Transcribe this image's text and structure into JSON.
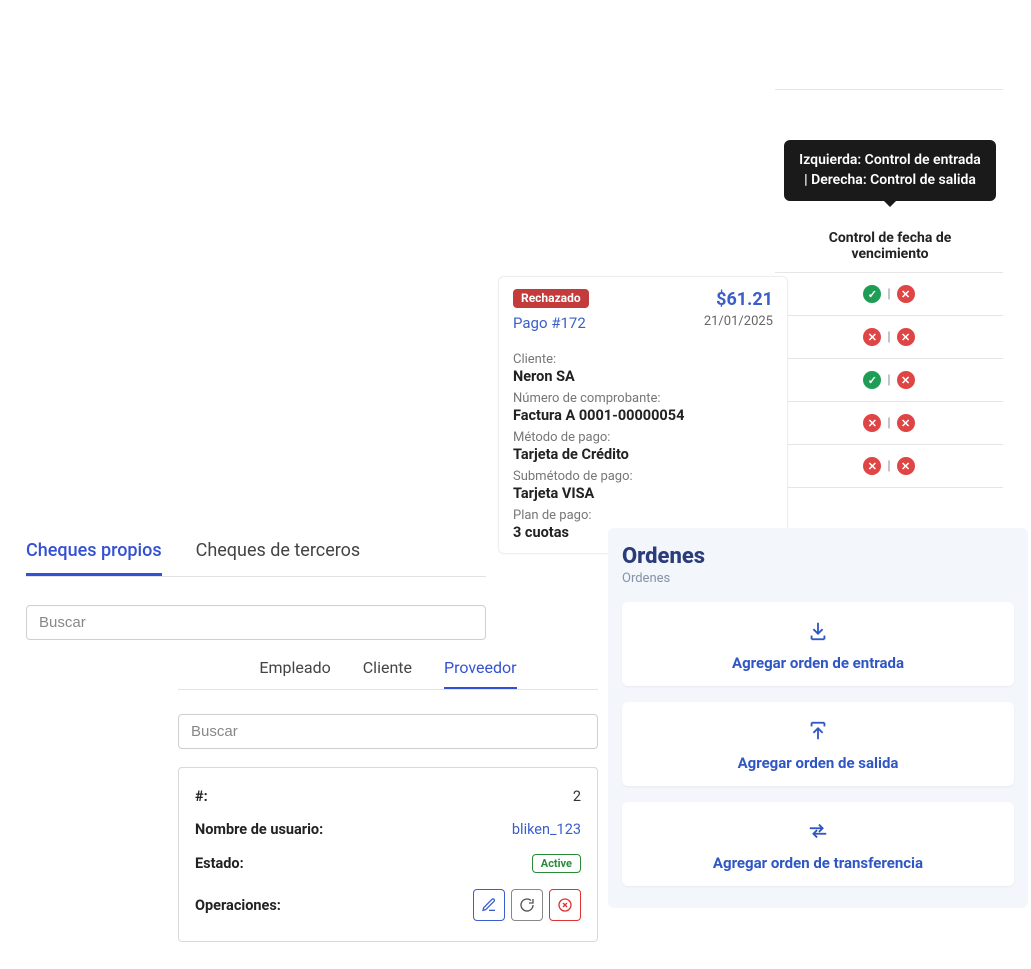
{
  "expiry": {
    "tooltip": "Izquierda: Control de entrada | Derecha: Control de salida",
    "header": "Control de fecha de vencimiento",
    "rows": [
      {
        "left": "ok",
        "right": "no"
      },
      {
        "left": "no",
        "right": "no"
      },
      {
        "left": "ok",
        "right": "no"
      },
      {
        "left": "no",
        "right": "no"
      },
      {
        "left": "no",
        "right": "no"
      }
    ],
    "separator": "|"
  },
  "payment": {
    "status_badge": "Rechazado",
    "title": "Pago #172",
    "amount": "$61.21",
    "date": "21/01/2025",
    "fields": {
      "client_label": "Cliente:",
      "client_value": "Neron SA",
      "receipt_label": "Número de comprobante:",
      "receipt_value": "Factura A 0001-00000054",
      "method_label": "Método de pago:",
      "method_value": "Tarjeta de Crédito",
      "submethod_label": "Submétodo de pago:",
      "submethod_value": "Tarjeta VISA",
      "plan_label": "Plan de pago:",
      "plan_value": "3 cuotas"
    }
  },
  "cheques": {
    "tabs": {
      "own": "Cheques propios",
      "third": "Cheques de terceros"
    },
    "search_placeholder": "Buscar"
  },
  "entity": {
    "tabs": {
      "employee": "Empleado",
      "client": "Cliente",
      "supplier": "Proveedor"
    },
    "search_placeholder": "Buscar",
    "details": {
      "id_label": "#:",
      "id_value": "2",
      "username_label": "Nombre de usuario:",
      "username_value": "bliken_123",
      "state_label": "Estado:",
      "state_badge": "Active",
      "ops_label": "Operaciones:"
    }
  },
  "orders": {
    "title": "Ordenes",
    "subtitle": "Ordenes",
    "actions": {
      "in": "Agregar orden de entrada",
      "out": "Agregar orden de salida",
      "transfer": "Agregar orden de transferencia"
    }
  }
}
